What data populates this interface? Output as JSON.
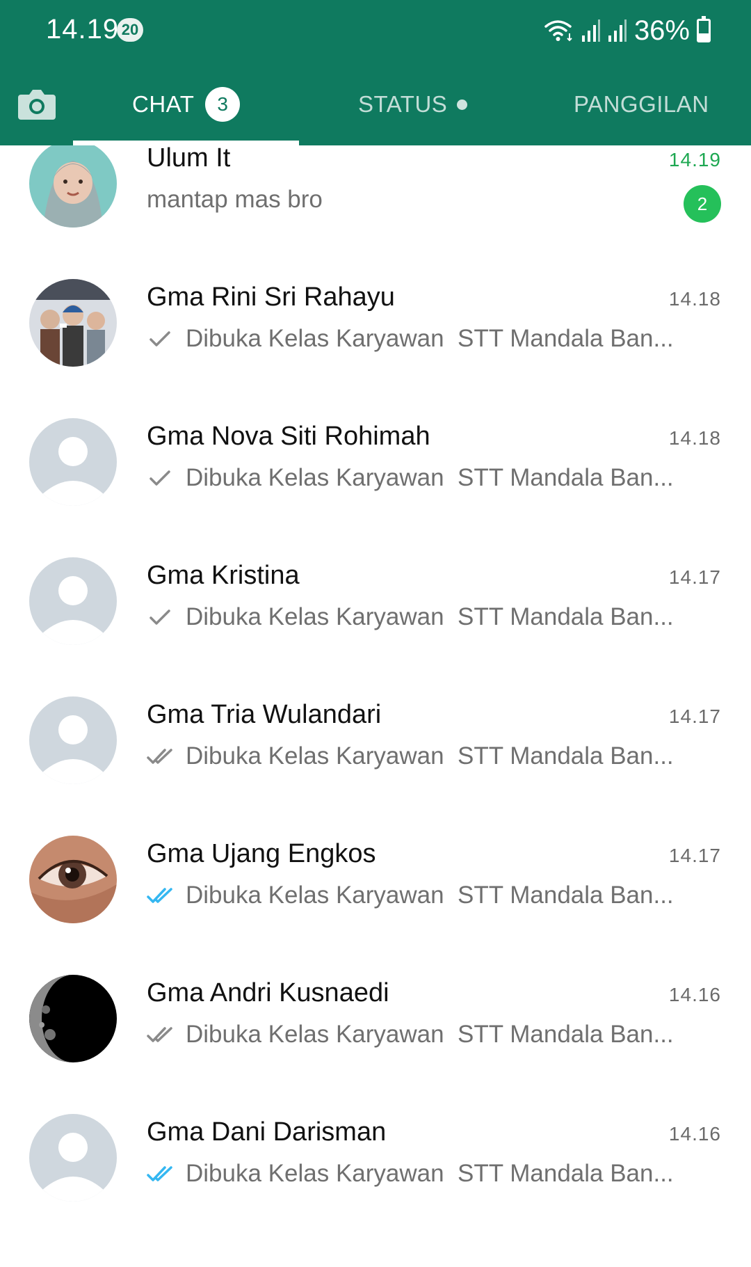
{
  "status_bar": {
    "time": "14.19",
    "notification_count": "20",
    "battery": "36%",
    "battery_level": 0.36
  },
  "tabs": {
    "chat_label": "CHAT",
    "chat_count": "3",
    "status_label": "STATUS",
    "calls_label": "PANGGILAN"
  },
  "colors": {
    "brand": "#0f7a5f",
    "unread": "#25c05a",
    "read_tick": "#34b7f1",
    "default_avatar_bg": "#cfd7de"
  },
  "chats": [
    {
      "name": "Ulum It",
      "time": "14.19",
      "preview": "mantap mas bro",
      "tick": "none",
      "unread": "2",
      "avatar": "photo-baby"
    },
    {
      "name": "Gma Rini Sri Rahayu",
      "time": "14.18",
      "preview": "Dibuka Kelas Karyawan  STT Mandala Ban...",
      "tick": "single",
      "avatar": "photo-group"
    },
    {
      "name": "Gma Nova Siti Rohimah",
      "time": "14.18",
      "preview": "Dibuka Kelas Karyawan  STT Mandala Ban...",
      "tick": "single",
      "avatar": "default"
    },
    {
      "name": "Gma Kristina",
      "time": "14.17",
      "preview": "Dibuka Kelas Karyawan  STT Mandala Ban...",
      "tick": "single",
      "avatar": "default"
    },
    {
      "name": "Gma Tria Wulandari",
      "time": "14.17",
      "preview": "Dibuka Kelas Karyawan  STT Mandala Ban...",
      "tick": "double-grey",
      "avatar": "default"
    },
    {
      "name": "Gma Ujang Engkos",
      "time": "14.17",
      "preview": "Dibuka Kelas Karyawan  STT Mandala Ban...",
      "tick": "double-blue",
      "avatar": "photo-eye"
    },
    {
      "name": "Gma Andri Kusnaedi",
      "time": "14.16",
      "preview": "Dibuka Kelas Karyawan  STT Mandala Ban...",
      "tick": "double-grey",
      "avatar": "photo-moon"
    },
    {
      "name": "Gma Dani Darisman",
      "time": "14.16",
      "preview": "Dibuka Kelas Karyawan  STT Mandala Ban...",
      "tick": "double-blue",
      "avatar": "default"
    }
  ]
}
